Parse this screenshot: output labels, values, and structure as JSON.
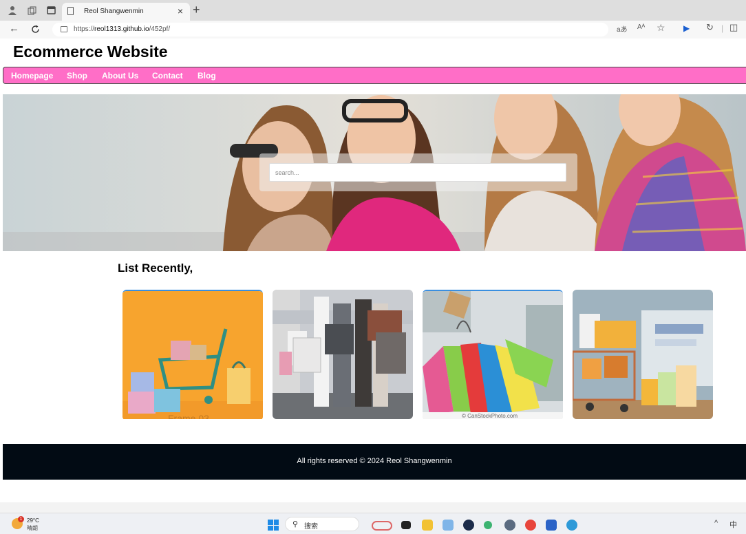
{
  "browser": {
    "tab_title": "Reol Shangwenmin",
    "tab_close": "×",
    "new_tab": "+",
    "url_prefix": "https://",
    "url_host": "reol1313.github.io",
    "url_path": "/452pf/",
    "read_aloud": "aあ",
    "text_size": "Aᴬ",
    "favorite": "☆",
    "media": "▶",
    "refresh_ext": "↻",
    "split": "◫"
  },
  "page": {
    "site_title": "Ecommerce Website",
    "nav": [
      "Homepage",
      "Shop",
      "About Us",
      "Contact",
      "Blog"
    ],
    "search": {
      "placeholder": "search..."
    },
    "section_title": "List Recently,",
    "cards": [
      {
        "caption": "Frame 03"
      },
      {
        "caption": ""
      },
      {
        "caption": "© CanStockPhoto.com"
      },
      {
        "caption": ""
      }
    ],
    "footer": "All rights reserved © 2024 Reol Shangwenmin",
    "colors": {
      "nav": "#ff6ec7",
      "footer": "#020b14"
    }
  },
  "taskbar": {
    "weather_temp": "29°C",
    "weather_desc": "晴朗",
    "weather_badge": "1",
    "search_label": "搜索",
    "tray_chevron": "^",
    "tray_ime": "中"
  }
}
